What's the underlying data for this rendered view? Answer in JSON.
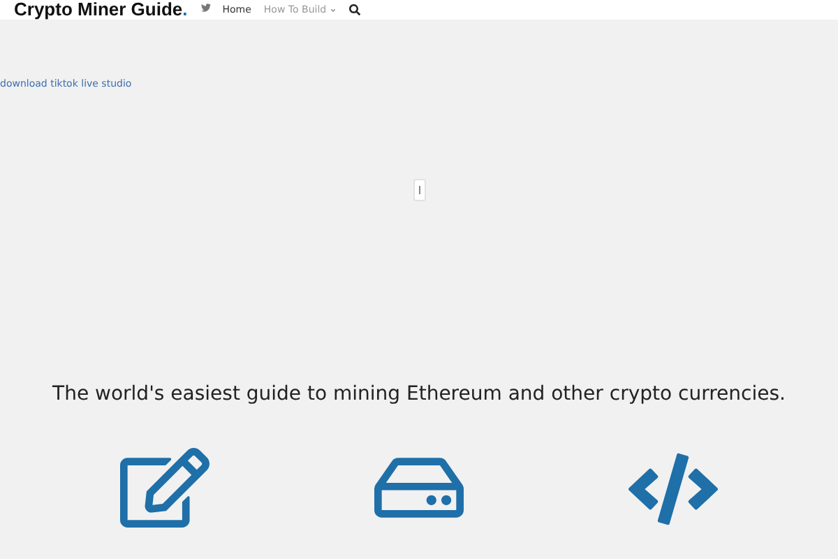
{
  "header": {
    "logo": {
      "text": "Crypto Miner Guide",
      "mark": "."
    },
    "nav": [
      {
        "label": "Home",
        "selected": true,
        "dropdown": false
      },
      {
        "label": "How To Build",
        "selected": false,
        "dropdown": true
      }
    ]
  },
  "ad_link": "download tiktok live studio",
  "tagline": "The world's easiest guide to mining Ethereum and other crypto currencies.",
  "features": [
    {
      "kind": "edit"
    },
    {
      "kind": "drive"
    },
    {
      "kind": "code"
    }
  ]
}
